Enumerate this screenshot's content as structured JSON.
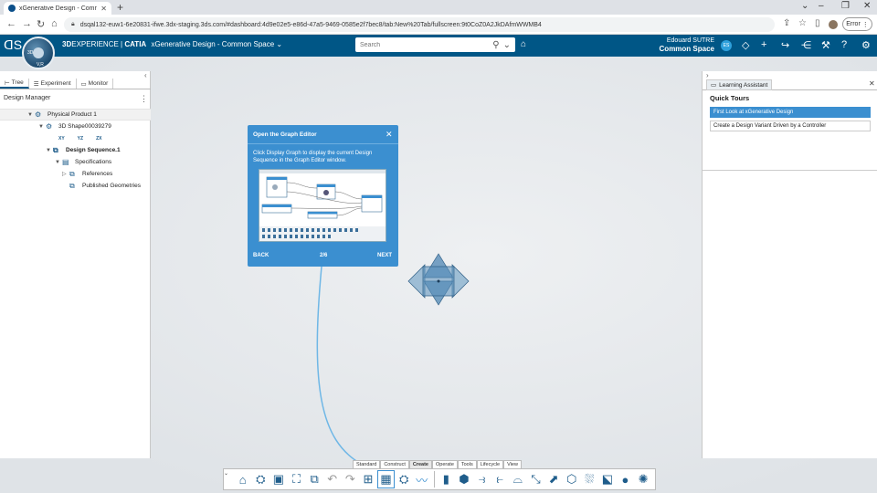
{
  "browser": {
    "tab_title": "xGenerative Design - Common S",
    "url": "dsqal132-euw1-6e20831-ifwe.3dx-staging.3ds.com/#dashboard:4d9e02e5-e86d-47a5-9469-0585e2f7bec8/tab:New%20Tab/fullscreen:9t0CoZ0A2JkDAfmWWMB4",
    "error_label": "Error"
  },
  "header": {
    "brand_3d": "3D",
    "brand_experience": "EXPERIENCE",
    "brand_catia": "CATIA",
    "app_title": "xGenerative Design - Common Space",
    "search_placeholder": "Search",
    "user_name": "Edouard SUTRE",
    "user_space": "Common Space",
    "avatar_initials": "ES",
    "compass_top": "3D",
    "compass_bottom": "V,R"
  },
  "left_panel": {
    "tabs": [
      "Tree",
      "Experiment",
      "Monitor"
    ],
    "title": "Design Manager",
    "tree": {
      "physical_product": "Physical Product 1",
      "shape": "3D Shape00039279",
      "mini_icons": [
        "XY",
        "YZ",
        "ZX"
      ],
      "design_sequence": "Design Sequence.1",
      "specifications": "Specifications",
      "references": "References",
      "published": "Published Geometries"
    }
  },
  "right_panel": {
    "tab": "Learning Assistant",
    "heading": "Quick Tours",
    "tours": [
      "First Look at xGenerative Design",
      "Create a Design Variant Driven by a Controller"
    ]
  },
  "popup": {
    "title": "Open the Graph Editor",
    "body": "Click Display Graph to display the current Design Sequence in the Graph Editor window.",
    "back": "BACK",
    "page": "2/6",
    "next": "NEXT"
  },
  "action_bar": {
    "tabs": [
      "Standard",
      "Construct",
      "Create",
      "Operate",
      "Tools",
      "Lifecycle",
      "View"
    ],
    "active_tab": "Create"
  },
  "colors": {
    "header_blue": "#005686",
    "accent_blue": "#3b8fd0"
  }
}
